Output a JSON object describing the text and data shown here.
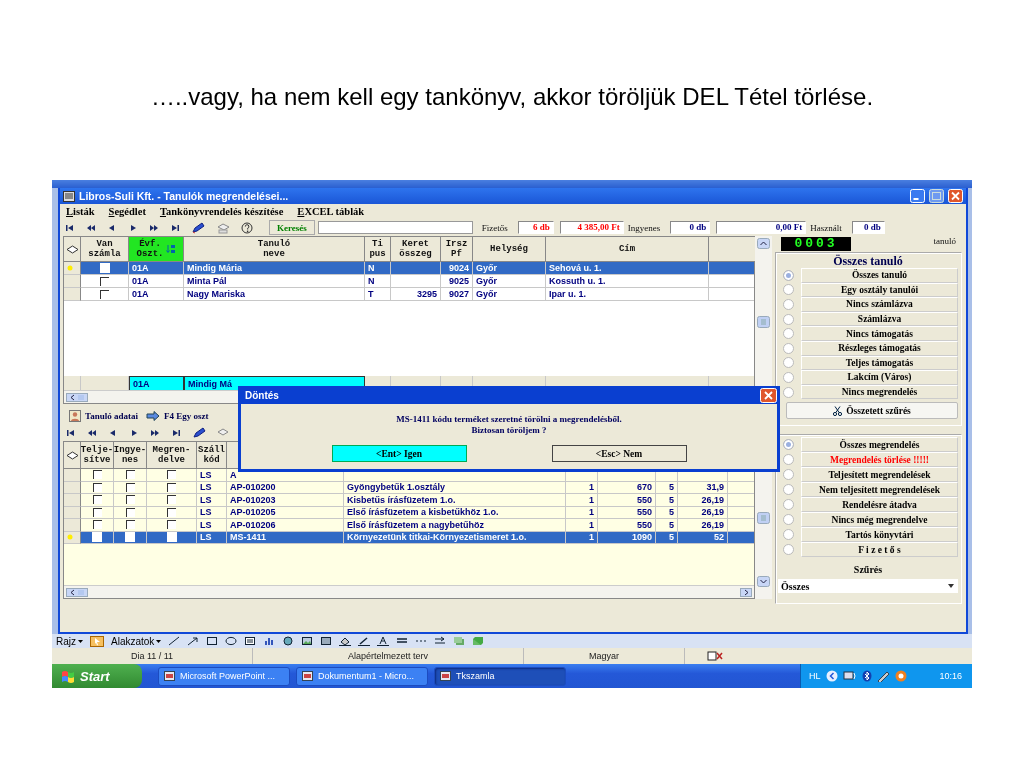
{
  "slide_title": "…..vagy, ha nem kell egy tankönyv, akkor töröljük DEL Tétel törlése.",
  "window": {
    "title": "Libros-Suli Kft. - Tanulók megrendelései..."
  },
  "menu": [
    "Listák",
    "Segédlet",
    "Tankönyvrendelés készítése",
    "EXCEL táblák"
  ],
  "toolbar": {
    "search_button": "Keresés"
  },
  "totals": [
    {
      "label": "Fizetős",
      "count": "6 db",
      "amount": "4 385,00 Ft",
      "color": "#ff0000"
    },
    {
      "label": "Ingyenes",
      "count": "0 db",
      "amount": "0,00 Ft",
      "color": "#000080"
    },
    {
      "label": "Használt",
      "count": "0 db",
      "color": "#000080"
    }
  ],
  "students_grid": {
    "columns": [
      {
        "label": "Van\nszámla",
        "sorted": false
      },
      {
        "label": "Évf.\nOszt.",
        "sorted": true
      },
      {
        "label": "Tanuló\nneve",
        "sorted": false
      },
      {
        "label": "Ti\npus",
        "sorted": false
      },
      {
        "label": "Keret\nösszeg",
        "sorted": false
      },
      {
        "label": "Irsz\nPf",
        "sorted": false
      },
      {
        "label": "Helység",
        "sorted": false
      },
      {
        "label": "Cím",
        "sorted": false
      }
    ],
    "rows": [
      {
        "selected": true,
        "invoiced": false,
        "class": "01A",
        "name": "Mindig Mária",
        "type": "N",
        "zip": "9024",
        "city": "Győr",
        "address": "Sehová u. 1."
      },
      {
        "selected": false,
        "invoiced": false,
        "class": "01A",
        "name": "Minta Pál",
        "type": "N",
        "zip": "9025",
        "city": "Győr",
        "address": "Kossuth u. 1."
      },
      {
        "selected": false,
        "invoiced": false,
        "class": "01A",
        "name": "Nagy Mariska",
        "type": "T",
        "budget": "3295",
        "zip": "9027",
        "city": "Győr",
        "address": "Ipar u. 1."
      }
    ],
    "footer": {
      "class": "01A",
      "name": "Mindig Má"
    }
  },
  "student_tools": [
    "Tanuló adatai",
    "F4 Egy oszt"
  ],
  "orders_grid": {
    "columns": [
      {
        "label": "Telje-\nsítve",
        "sorted": false
      },
      {
        "label": "Ingye-\nnes",
        "sorted": false
      },
      {
        "label": "Megren-\ndelve",
        "sorted": false
      },
      {
        "label": "Száll\nkód",
        "sorted": false
      }
    ],
    "rows": [
      {
        "selected": false,
        "completed": false,
        "free": false,
        "ordered": false,
        "ship": "LS",
        "code": "A"
      },
      {
        "selected": false,
        "completed": false,
        "free": false,
        "ordered": false,
        "ship": "LS",
        "code": "AP-010200",
        "title": "Gyöngybetűk 1.osztály",
        "qty": "1",
        "price": "670",
        "column_9": "5",
        "column_10": "31,9"
      },
      {
        "selected": false,
        "completed": false,
        "free": false,
        "ordered": false,
        "ship": "LS",
        "code": "AP-010203",
        "title": "Kisbetűs írásfüzetem 1.o.",
        "qty": "1",
        "price": "550",
        "column_9": "5",
        "column_10": "26,19"
      },
      {
        "selected": false,
        "completed": false,
        "free": false,
        "ordered": false,
        "ship": "LS",
        "code": "AP-010205",
        "title": "Első írásfüzetem a kisbetűkhöz 1.o.",
        "qty": "1",
        "price": "550",
        "column_9": "5",
        "column_10": "26,19"
      },
      {
        "selected": false,
        "completed": false,
        "free": false,
        "ordered": false,
        "ship": "LS",
        "code": "AP-010206",
        "title": "Első írásfüzetem a nagybetűhöz",
        "qty": "1",
        "price": "550",
        "column_9": "5",
        "column_10": "26,19"
      },
      {
        "selected": true,
        "completed": false,
        "free": false,
        "ordered": false,
        "ship": "LS",
        "code": "MS-1411",
        "title": "Környezetünk titkai-Környezetismeret 1.o.",
        "qty": "1",
        "price": "1090",
        "column_9": "5",
        "column_10": "52"
      }
    ]
  },
  "right_panel": {
    "counter": "0003",
    "counter_label": "tanuló",
    "student_title": "Összes tanuló",
    "student_filters": [
      {
        "label": "Összes tanuló",
        "selected": true
      },
      {
        "label": "Egy osztály tanulói",
        "selected": false
      },
      {
        "label": "Nincs számlázva",
        "selected": false
      },
      {
        "label": "Számlázva",
        "selected": false
      },
      {
        "label": "Nincs támogatás",
        "selected": false
      },
      {
        "label": "Részleges támogatás",
        "selected": false
      },
      {
        "label": "Teljes támogatás",
        "selected": false
      },
      {
        "label": "Lakcím (Város)",
        "selected": false
      },
      {
        "label": "Nincs megrendelés",
        "selected": false
      }
    ],
    "combined_filter": "Összetett szűrés",
    "order_filters": [
      {
        "label": "Összes megrendelés",
        "selected": true,
        "kind": "normal"
      },
      {
        "label": "Megrendelés törlése !!!!!",
        "selected": false,
        "kind": "danger"
      },
      {
        "label": "Teljesített megrendelések",
        "selected": false,
        "kind": "normal"
      },
      {
        "label": "Nem teljesített megrendelések",
        "selected": false,
        "kind": "normal"
      },
      {
        "label": "Rendelésre átadva",
        "selected": false,
        "kind": "normal"
      },
      {
        "label": "Nincs még megrendelve",
        "selected": false,
        "kind": "normal"
      },
      {
        "label": "Tartós könyvtári",
        "selected": false,
        "kind": "normal"
      },
      {
        "label": "F i z e t ő s",
        "selected": false,
        "kind": "normal"
      }
    ],
    "filter_label": "Szűrés",
    "filter_value": "Összes"
  },
  "dialog": {
    "title": "Döntés",
    "message": [
      "MS-1411 kódu terméket szeretné törölni a megrendelésből.",
      "Biztosan töröljem ?"
    ],
    "buttons": [
      {
        "label": "<Ent> Igen",
        "default": true
      },
      {
        "label": "<Esc> Nem",
        "default": false
      }
    ]
  },
  "drawing_toolbar": [
    "Rajz",
    "Alakzatok"
  ],
  "status_bar": [
    "Dia 11 / 11",
    "Alapértelmezett terv",
    "Magyar"
  ],
  "taskbar": {
    "start": "Start",
    "tasks": [
      {
        "label": "Microsoft PowerPoint ...",
        "selected": false
      },
      {
        "label": "Dokumentum1 - Micro...",
        "selected": false
      },
      {
        "label": "Tkszamla",
        "selected": true
      }
    ],
    "language": "HL",
    "time": "10:16"
  }
}
